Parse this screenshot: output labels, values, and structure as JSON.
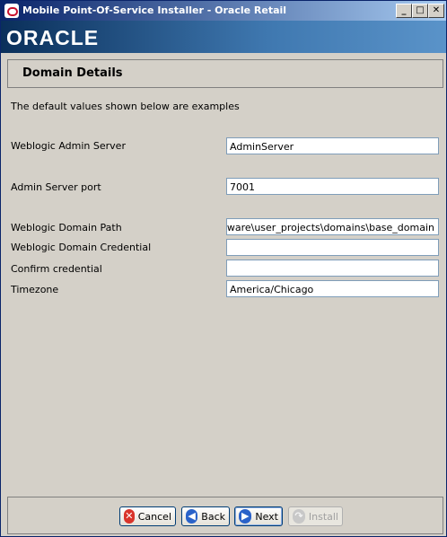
{
  "window": {
    "title": "Mobile Point-Of-Service Installer - Oracle Retail",
    "minimize_glyph": "_",
    "maximize_glyph": "□",
    "close_glyph": "✕"
  },
  "banner": {
    "logo_text": "ORACLE"
  },
  "page": {
    "title": "Domain Details",
    "description": "The default values shown below are examples"
  },
  "form": {
    "admin_server": {
      "label": "Weblogic Admin Server",
      "value": "AdminServer"
    },
    "admin_port": {
      "label": "Admin Server port",
      "value": "7001"
    },
    "domain_path": {
      "label": "Weblogic Domain Path",
      "value": "/iddleware\\user_projects\\domains\\base_domain"
    },
    "domain_credential": {
      "label": "Weblogic Domain Credential",
      "value": ""
    },
    "confirm_credential": {
      "label": "Confirm credential",
      "value": ""
    },
    "timezone": {
      "label": "Timezone",
      "value": "America/Chicago"
    }
  },
  "buttons": {
    "cancel": "Cancel",
    "back": "Back",
    "next": "Next",
    "install": "Install"
  },
  "colors": {
    "accent": "#0a246a",
    "oracle_red": "#c8102e",
    "cancel_icon": "#d9342b",
    "nav_icon": "#2a62c9"
  },
  "icons": {
    "cancel": "cancel-x-icon",
    "back": "arrow-left-icon",
    "next": "arrow-right-icon",
    "install": "install-arrow-icon"
  }
}
